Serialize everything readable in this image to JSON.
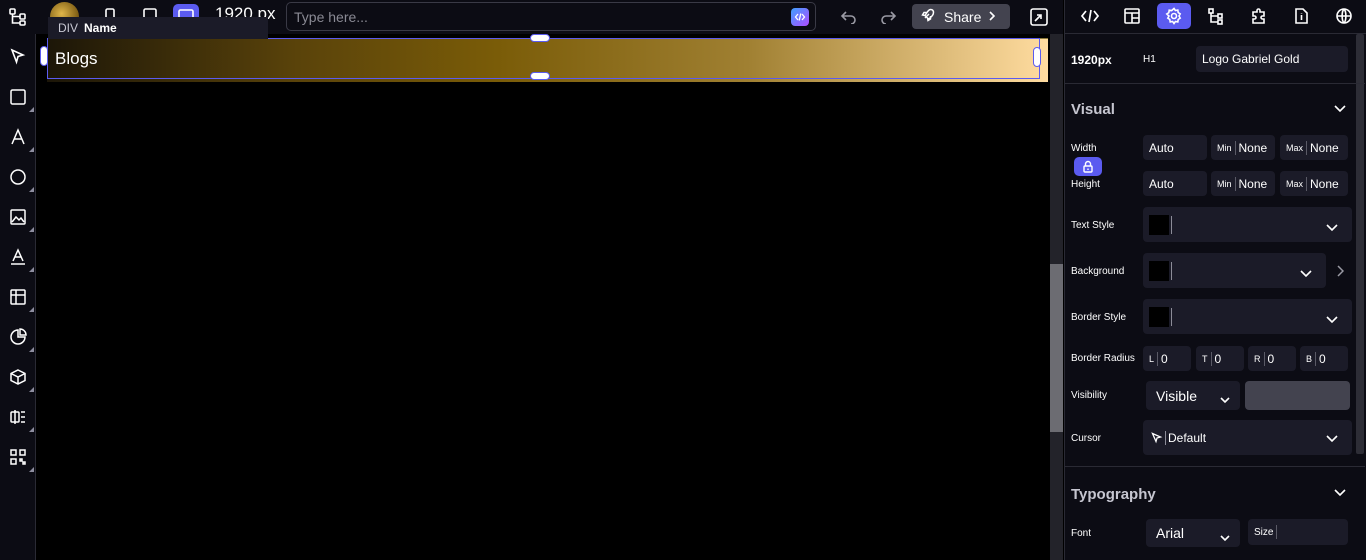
{
  "topbar": {
    "resolution": "1920 px",
    "search_placeholder": "Type here...",
    "share_label": "Share",
    "icons": [
      "tree-icon",
      "mobile-icon",
      "tablet-icon",
      "desktop-icon",
      "code-ai-icon",
      "undo-icon",
      "redo-icon",
      "rocket-icon",
      "expand-icon"
    ]
  },
  "selected_chip": {
    "tag": "DIV",
    "name": "Name"
  },
  "canvas": {
    "text": "Blogs"
  },
  "left_toolbar": {
    "tools": [
      "select-icon",
      "square-icon",
      "text-icon",
      "circle-icon",
      "image-icon",
      "text-input-icon",
      "table-icon",
      "chart-icon",
      "cube-icon",
      "form-icon",
      "qr-icon"
    ]
  },
  "right_panel": {
    "tabs": [
      "code",
      "layout",
      "settings",
      "tree",
      "plugin",
      "document",
      "globe"
    ],
    "active_tab": "settings",
    "breakpoint": "1920px",
    "element_tag": "H1",
    "element_name": "Logo Gabriel Gold",
    "visual": {
      "title": "Visual",
      "width_label": "Width",
      "height_label": "Height",
      "width_value": "Auto",
      "height_value": "Auto",
      "min_label": "Min",
      "max_label": "Max",
      "min_width": "None",
      "max_width": "None",
      "min_height": "None",
      "max_height": "None",
      "text_style_label": "Text Style",
      "background_label": "Background",
      "border_style_label": "Border Style",
      "border_radius_label": "Border Radius",
      "radius": [
        {
          "side": "L",
          "value": "0"
        },
        {
          "side": "T",
          "value": "0"
        },
        {
          "side": "R",
          "value": "0"
        },
        {
          "side": "B",
          "value": "0"
        }
      ],
      "visibility_label": "Visibility",
      "visibility_value": "Visible",
      "cursor_label": "Cursor",
      "cursor_value": "Default"
    },
    "typography": {
      "title": "Typography",
      "font_label": "Font",
      "font_value": "Arial",
      "size_label": "Size"
    }
  },
  "colors": {
    "accent": "#5b5bf0",
    "panel_bg": "#0c0c14",
    "field_bg": "#1b1b28",
    "gradient_end": "#ffdca0"
  }
}
